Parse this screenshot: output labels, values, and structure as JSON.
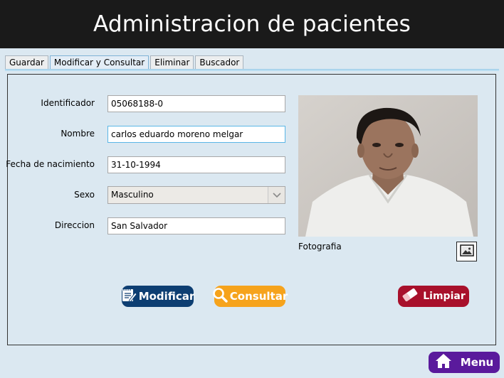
{
  "header": {
    "title": "Administracion de pacientes"
  },
  "tabs": [
    {
      "label": "Guardar"
    },
    {
      "label": "Modificar y Consultar"
    },
    {
      "label": "Eliminar"
    },
    {
      "label": "Buscador"
    }
  ],
  "active_tab": "Modificar y Consultar",
  "form": {
    "identificador": {
      "label": "Identificador",
      "value": "05068188-0"
    },
    "nombre": {
      "label": "Nombre",
      "value": "carlos eduardo moreno melgar"
    },
    "fecha": {
      "label": "Fecha de nacimiento",
      "value": "31-10-1994"
    },
    "sexo": {
      "label": "Sexo",
      "value": "Masculino"
    },
    "direccion": {
      "label": "Direccion",
      "value": "San Salvador"
    }
  },
  "photo": {
    "caption": "Fotografia"
  },
  "buttons": {
    "modificar": "Modificar",
    "consultar": "Consultar",
    "limpiar": "Limpiar",
    "menu": "Menu"
  },
  "colors": {
    "header_bg": "#1a1a1a",
    "modificar": "#0d3e72",
    "consultar": "#f6a31c",
    "limpiar": "#a8102b",
    "menu": "#5a1a9c"
  },
  "icons": {
    "modificar": "edit-notepad-icon",
    "consultar": "magnifier-icon",
    "limpiar": "eraser-icon",
    "menu": "home-icon",
    "photo": "image-icon",
    "dropdown": "chevron-down-icon"
  }
}
